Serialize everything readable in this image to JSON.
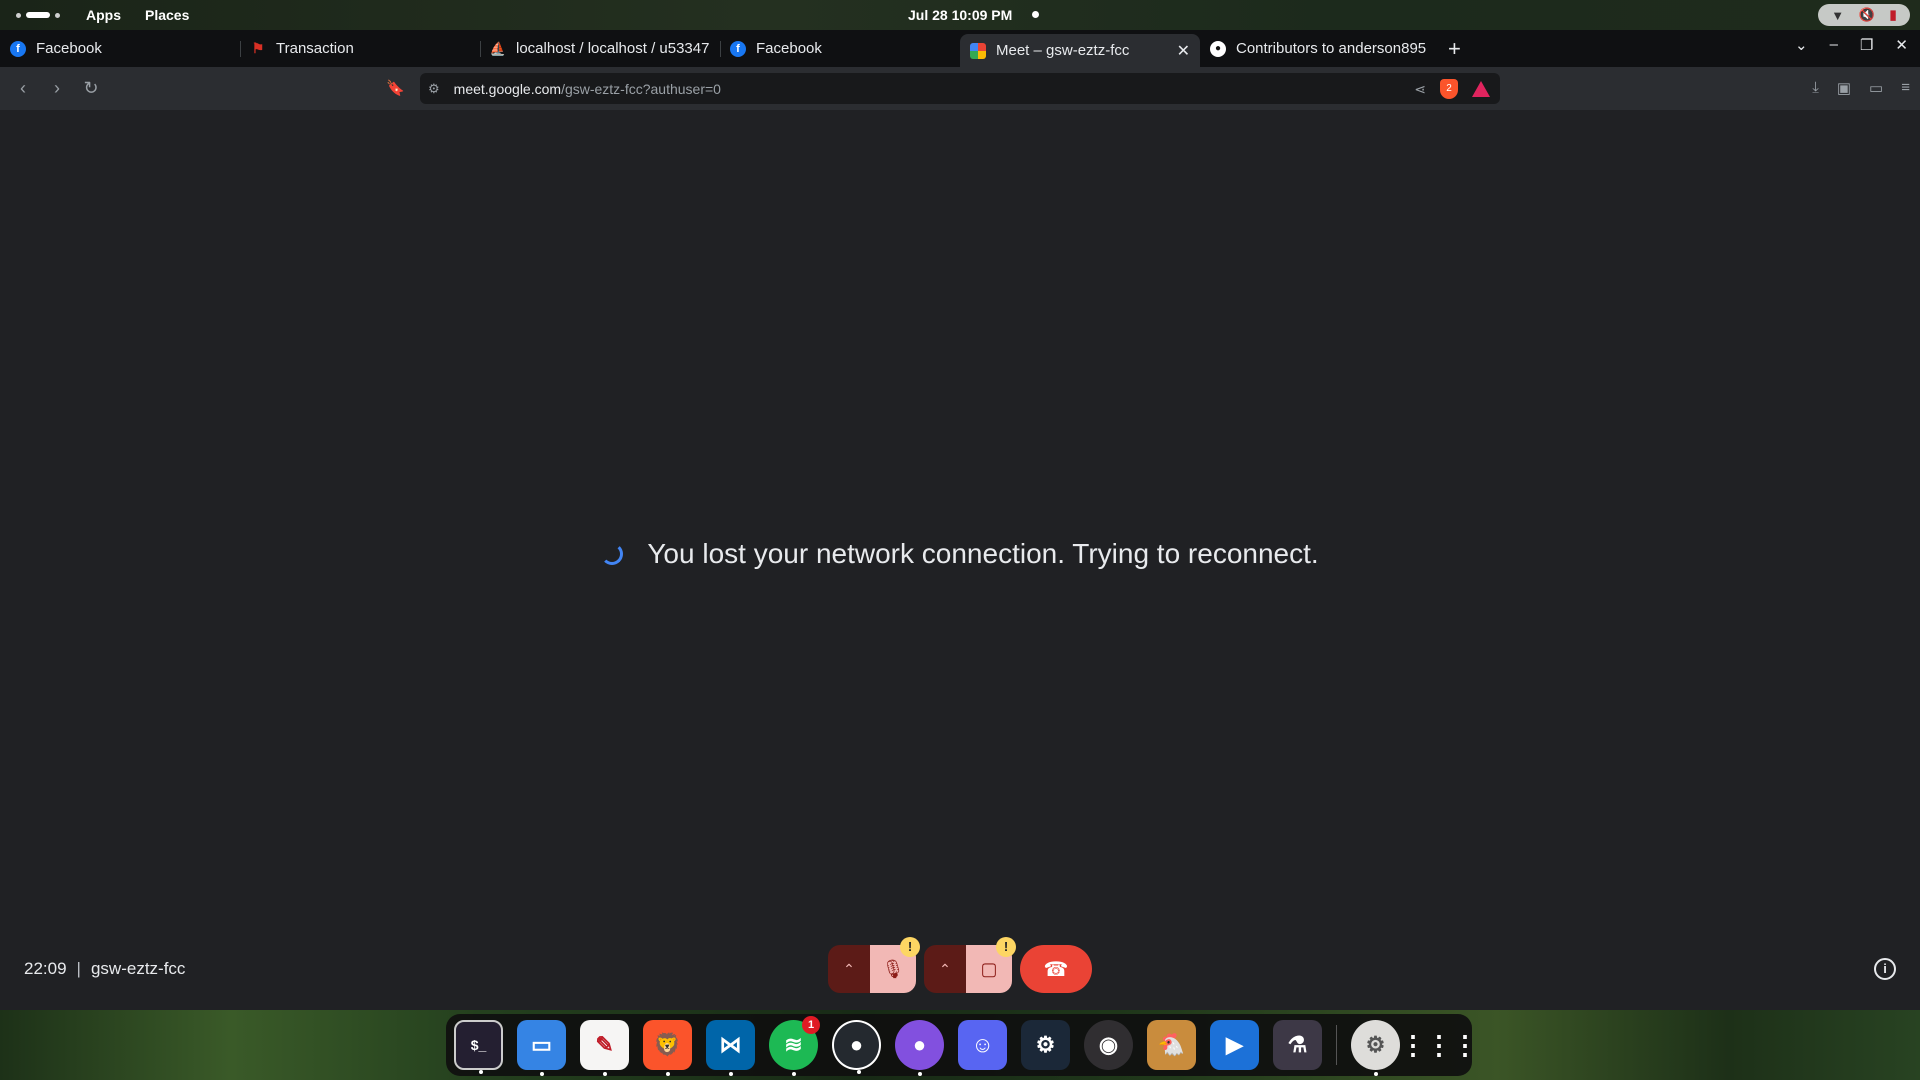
{
  "topbar": {
    "apps_label": "Apps",
    "places_label": "Places",
    "clock": "Jul 28  10:09 PM"
  },
  "tabs": [
    {
      "title": "Facebook",
      "favicon": "facebook-icon"
    },
    {
      "title": "Transaction",
      "favicon": "transaction-icon"
    },
    {
      "title": "localhost / localhost / u53347",
      "favicon": "phpmyadmin-icon"
    },
    {
      "title": "Facebook",
      "favicon": "facebook-icon"
    },
    {
      "title": "Meet – gsw-eztz-fcc",
      "favicon": "google-meet-icon",
      "active": true
    },
    {
      "title": "Contributors to anderson895",
      "favicon": "github-icon"
    }
  ],
  "toolbar": {
    "url_host": "meet.google.com",
    "url_path": "/gsw-eztz-fcc?authuser=0",
    "shield_count": "2"
  },
  "meet": {
    "status_message": "You lost your network connection. Trying to reconnect.",
    "time": "22:09",
    "separator": "|",
    "meeting_code": "gsw-eztz-fcc",
    "mic_warning": "!",
    "camera_warning": "!"
  },
  "dock": {
    "apps": [
      "terminal",
      "files",
      "text-editor",
      "brave",
      "vscode",
      "spotify",
      "github-desktop",
      "github",
      "discord",
      "steam",
      "obs",
      "game",
      "kdenlive",
      "tweaks",
      "settings",
      "app-grid"
    ],
    "spotify_badge": "1"
  },
  "colors": {
    "page_bg": "#202124",
    "hangup_red": "#ea4335",
    "muted_pink": "#f2b8b5",
    "spinner_blue": "#4285f4",
    "warning_yellow": "#fdd663"
  }
}
